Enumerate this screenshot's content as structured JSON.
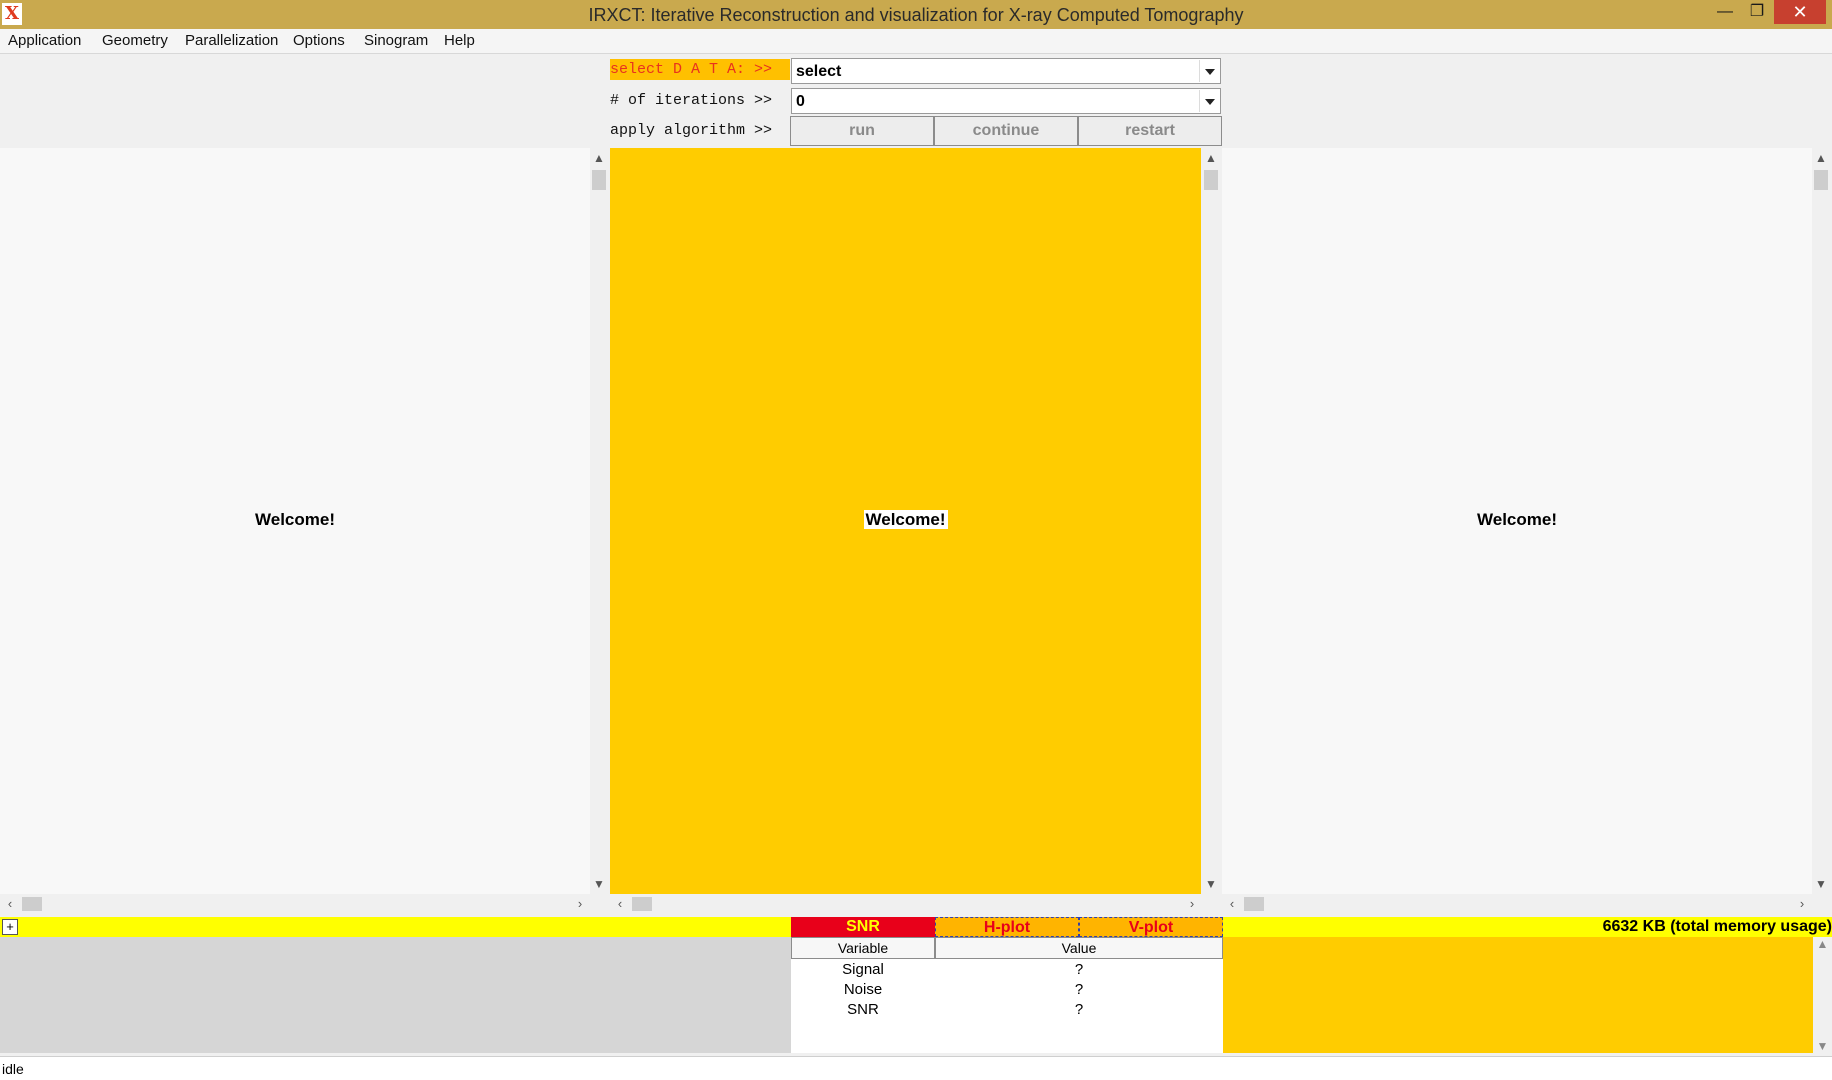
{
  "window": {
    "title": "IRXCT: Iterative Reconstruction and visualization for X-ray Computed Tomography",
    "icon_letter": "X",
    "minimize": "—",
    "maximize": "❐",
    "close": "✕"
  },
  "menu": [
    {
      "label": "Application"
    },
    {
      "label": "Geometry"
    },
    {
      "label": "Parallelization"
    },
    {
      "label": "Options"
    },
    {
      "label": "Sinogram"
    },
    {
      "label": "Help"
    }
  ],
  "controls": {
    "data_label": "select D A T A: >>",
    "data_value": "select",
    "iterations_label": "# of iterations >>",
    "iterations_value": "0",
    "apply_label": "apply algorithm >>",
    "buttons": {
      "run": "run",
      "continue": "continue",
      "restart": "restart"
    }
  },
  "panels": {
    "left_text": "Welcome!",
    "mid_text": "Welcome!",
    "right_text": "Welcome!"
  },
  "bottom": {
    "plus": "+",
    "tabs": {
      "snr": "SNR",
      "hplot": "H-plot",
      "vplot": "V-plot"
    },
    "memory": "6632 KB (total memory usage)",
    "table": {
      "headers": {
        "variable": "Variable",
        "value": "Value"
      },
      "rows": [
        {
          "variable": "Signal",
          "value": "?"
        },
        {
          "variable": "Noise",
          "value": "?"
        },
        {
          "variable": "SNR",
          "value": "?"
        }
      ]
    }
  },
  "status": "idle",
  "colors": {
    "titlebar": "#c9a94e",
    "accent_yellow": "#ffcc00",
    "strip_yellow": "#ffff00",
    "snr_red": "#e8001a"
  }
}
